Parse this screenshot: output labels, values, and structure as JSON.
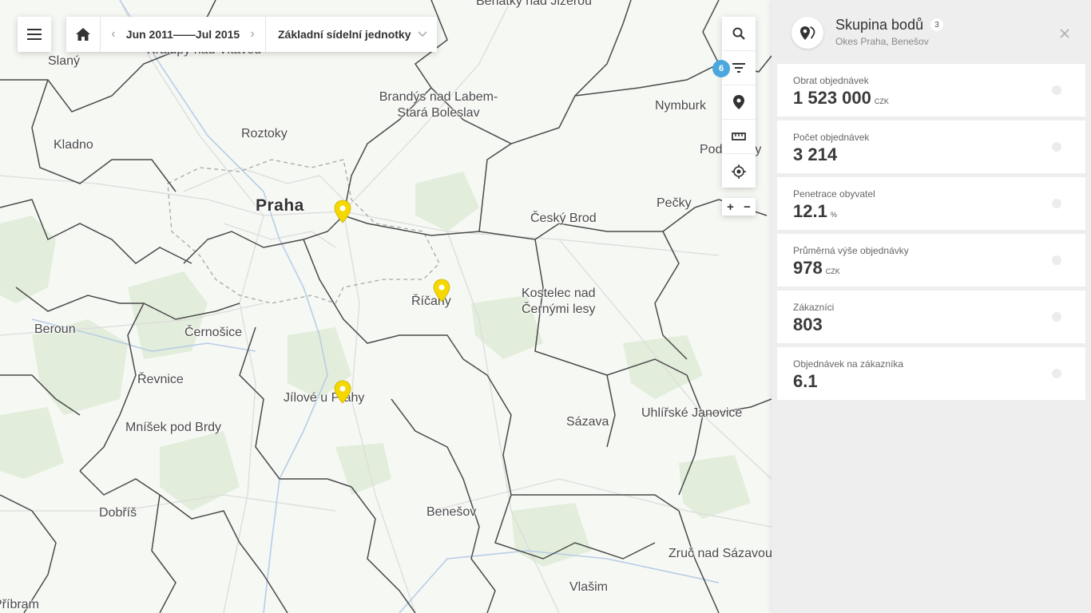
{
  "toolbar": {
    "date_range": "Jun 2011——Jul 2015",
    "layer": "Základní sídelní jednotky",
    "prev_arrow": "‹",
    "next_arrow": "›"
  },
  "tools": {
    "filter_count": "6",
    "zoom_in": "+",
    "zoom_out": "−"
  },
  "map": {
    "places": [
      "Benátky nad Jizerou",
      "Kralupy nad Vltavou",
      "Slaný",
      "Brandýs nad Labem-",
      "Stará Boleslav",
      "Nymburk",
      "Roztoky",
      "Kladno",
      "Podebrady",
      "Praha",
      "Český Brod",
      "Pečky",
      "Říčany",
      "Kostelec nad",
      "Černými lesy",
      "Beroun",
      "Černošice",
      "Řevnice",
      "Jílové u Prahy",
      "Uhlířské Janovice",
      "Sázava",
      "Mníšek pod Brdy",
      "Dobříš",
      "Benešov",
      "Zruč nad Sázavou",
      "Vlašim",
      "Příbram"
    ]
  },
  "panel": {
    "title": "Skupina bodů",
    "count": "3",
    "subtitle": "Okes Praha, Benešov",
    "metrics": [
      {
        "label": "Obrat objednávek",
        "value": "1 523 000",
        "unit": "CZK"
      },
      {
        "label": "Počet objednávek",
        "value": "3 214",
        "unit": ""
      },
      {
        "label": "Penetrace obyvatel",
        "value": "12.1",
        "unit": "%"
      },
      {
        "label": "Průměrná výše objednávky",
        "value": "978",
        "unit": "CZK"
      },
      {
        "label": "Zákazníci",
        "value": "803",
        "unit": ""
      },
      {
        "label": "Objednávek na zákazníka",
        "value": "6.1",
        "unit": ""
      }
    ]
  },
  "colors": {
    "pin": "#f5d800",
    "badge": "#4aa8de",
    "panel_bg": "#eeeeee"
  },
  "icons": [
    "menu-icon",
    "home-icon",
    "chevron-down-icon",
    "search-icon",
    "filter-icon",
    "location-pin-icon",
    "ruler-icon",
    "locate-icon",
    "close-icon",
    "map-pin-group-icon"
  ]
}
